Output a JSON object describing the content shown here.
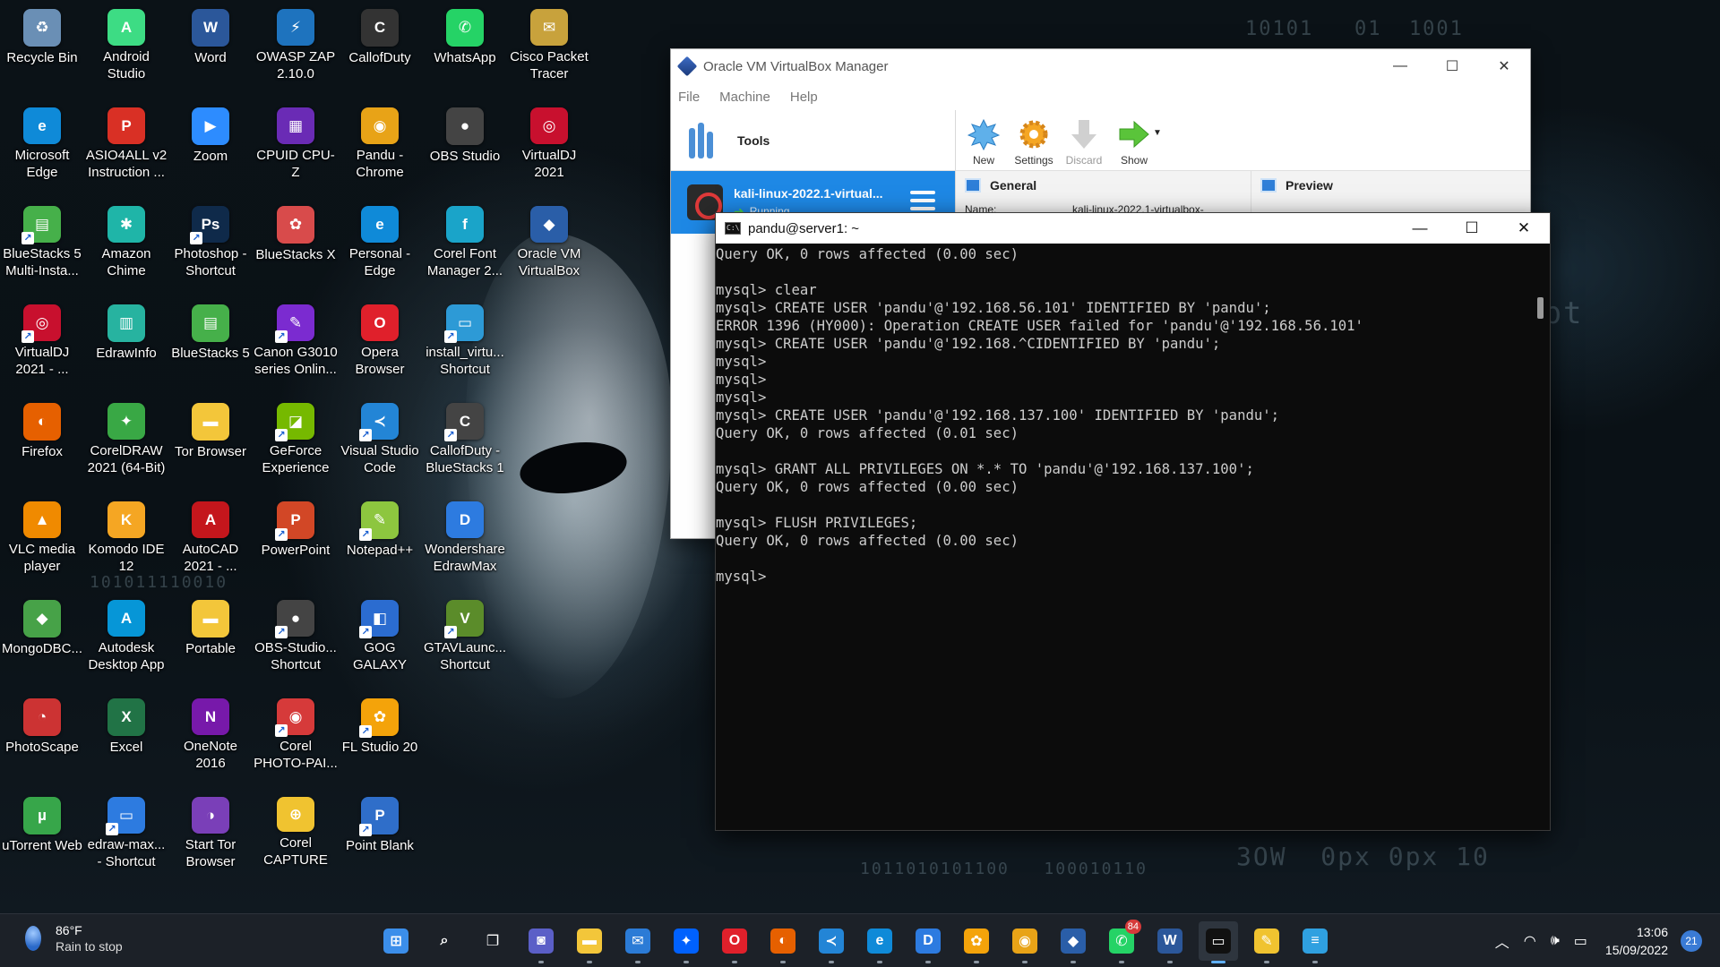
{
  "desktop": {
    "icons": [
      {
        "label": "Recycle Bin",
        "glyph": "♻",
        "color": "#6a8fb5",
        "shortcut": false
      },
      {
        "label": "Android\nStudio",
        "glyph": "A",
        "color": "#3ddc84",
        "shortcut": false
      },
      {
        "label": "Word",
        "glyph": "W",
        "color": "#2b579a",
        "shortcut": false
      },
      {
        "label": "OWASP ZAP\n2.10.0",
        "glyph": "⚡",
        "color": "#1e73be",
        "shortcut": false
      },
      {
        "label": "CallofDuty",
        "glyph": "C",
        "color": "#333333",
        "shortcut": false
      },
      {
        "label": "WhatsApp",
        "glyph": "✆",
        "color": "#25d366",
        "shortcut": false
      },
      {
        "label": "Cisco Packet\nTracer",
        "glyph": "✉",
        "color": "#c8a23c",
        "shortcut": false
      },
      {
        "label": "Microsoft\nEdge",
        "glyph": "e",
        "color": "#0f8ad8",
        "shortcut": false
      },
      {
        "label": "ASIO4ALL v2\nInstruction ...",
        "glyph": "P",
        "color": "#d93025",
        "shortcut": false
      },
      {
        "label": "Zoom",
        "glyph": "▶",
        "color": "#2d8cff",
        "shortcut": false
      },
      {
        "label": "CPUID CPU-Z",
        "glyph": "▦",
        "color": "#6a2bb5",
        "shortcut": false
      },
      {
        "label": "Pandu -\nChrome",
        "glyph": "◉",
        "color": "#e8a317",
        "shortcut": false
      },
      {
        "label": "OBS Studio",
        "glyph": "●",
        "color": "#444444",
        "shortcut": false
      },
      {
        "label": "VirtualDJ\n2021",
        "glyph": "◎",
        "color": "#c8102e",
        "shortcut": false
      },
      {
        "label": "BlueStacks 5\nMulti-Insta...",
        "glyph": "▤",
        "color": "#46b04a",
        "shortcut": true
      },
      {
        "label": "Amazon\nChime",
        "glyph": "✱",
        "color": "#1fb5a8",
        "shortcut": false
      },
      {
        "label": "Photoshop -\nShortcut",
        "glyph": "Ps",
        "color": "#0f2a4a",
        "shortcut": true
      },
      {
        "label": "BlueStacks X",
        "glyph": "✿",
        "color": "#d84b4b",
        "shortcut": false
      },
      {
        "label": "Personal -\nEdge",
        "glyph": "e",
        "color": "#0f8ad8",
        "shortcut": false
      },
      {
        "label": "Corel Font\nManager 2...",
        "glyph": "f",
        "color": "#1aa4c9",
        "shortcut": false
      },
      {
        "label": "Oracle VM\nVirtualBox",
        "glyph": "◆",
        "color": "#2a5ea8",
        "shortcut": false
      },
      {
        "label": "VirtualDJ\n2021 - ...",
        "glyph": "◎",
        "color": "#c8102e",
        "shortcut": true
      },
      {
        "label": "EdrawInfo",
        "glyph": "▥",
        "color": "#27b3a0",
        "shortcut": false
      },
      {
        "label": "BlueStacks 5",
        "glyph": "▤",
        "color": "#46b04a",
        "shortcut": false
      },
      {
        "label": "Canon G3010\nseries Onlin...",
        "glyph": "✎",
        "color": "#7b2bd0",
        "shortcut": true
      },
      {
        "label": "Opera\nBrowser",
        "glyph": "O",
        "color": "#e0202b",
        "shortcut": false
      },
      {
        "label": "install_virtu...\nShortcut",
        "glyph": "▭",
        "color": "#2d9ad6",
        "shortcut": true
      },
      {
        "label": "Firefox",
        "glyph": "◐",
        "color": "#e66000",
        "shortcut": false
      },
      {
        "label": "CorelDRAW\n2021 (64-Bit)",
        "glyph": "✦",
        "color": "#39a845",
        "shortcut": false
      },
      {
        "label": "Tor Browser",
        "glyph": "▬",
        "color": "#f3c63a",
        "shortcut": false
      },
      {
        "label": "GeForce\nExperience",
        "glyph": "◪",
        "color": "#76b900",
        "shortcut": true
      },
      {
        "label": "Visual Studio\nCode",
        "glyph": "≺",
        "color": "#2385d6",
        "shortcut": true
      },
      {
        "label": "CallofDuty -\nBlueStacks 1",
        "glyph": "C",
        "color": "#444444",
        "shortcut": true
      },
      {
        "label": "VLC media\nplayer",
        "glyph": "▲",
        "color": "#f08a00",
        "shortcut": false
      },
      {
        "label": "Komodo IDE\n12",
        "glyph": "K",
        "color": "#f5a623",
        "shortcut": false
      },
      {
        "label": "AutoCAD\n2021 - ...",
        "glyph": "A",
        "color": "#c4161c",
        "shortcut": false
      },
      {
        "label": "PowerPoint",
        "glyph": "P",
        "color": "#d24726",
        "shortcut": true
      },
      {
        "label": "Notepad++",
        "glyph": "✎",
        "color": "#8dc63f",
        "shortcut": true
      },
      {
        "label": "Wondershare\nEdrawMax",
        "glyph": "D",
        "color": "#2d7be0",
        "shortcut": false
      },
      {
        "label": "MongoDBC...",
        "glyph": "◆",
        "color": "#47a248",
        "shortcut": false
      },
      {
        "label": "Autodesk\nDesktop App",
        "glyph": "A",
        "color": "#0696d7",
        "shortcut": false
      },
      {
        "label": "Portable",
        "glyph": "▬",
        "color": "#f3c63a",
        "shortcut": false
      },
      {
        "label": "OBS-Studio...\nShortcut",
        "glyph": "●",
        "color": "#444444",
        "shortcut": true
      },
      {
        "label": "GOG GALAXY",
        "glyph": "◧",
        "color": "#2b6cd0",
        "shortcut": true
      },
      {
        "label": "GTAVLaunc...\nShortcut",
        "glyph": "V",
        "color": "#5b8c2a",
        "shortcut": true
      },
      {
        "label": "PhotoScape",
        "glyph": "◔",
        "color": "#cc3333",
        "shortcut": false
      },
      {
        "label": "Excel",
        "glyph": "X",
        "color": "#217346",
        "shortcut": false
      },
      {
        "label": "OneNote\n2016",
        "glyph": "N",
        "color": "#7719aa",
        "shortcut": false
      },
      {
        "label": "Corel\nPHOTO-PAI...",
        "glyph": "◉",
        "color": "#d63a3a",
        "shortcut": true
      },
      {
        "label": "FL Studio 20",
        "glyph": "✿",
        "color": "#f4a30a",
        "shortcut": true
      },
      {
        "label": "uTorrent Web",
        "glyph": "µ",
        "color": "#37a64a",
        "shortcut": false
      },
      {
        "label": "edraw-max...\n- Shortcut",
        "glyph": "▭",
        "color": "#2d7be0",
        "shortcut": true
      },
      {
        "label": "Start Tor\nBrowser",
        "glyph": "◑",
        "color": "#7a3fb8",
        "shortcut": false
      },
      {
        "label": "Corel\nCAPTURE 2...",
        "glyph": "⊕",
        "color": "#f0c330",
        "shortcut": false
      },
      {
        "label": "Point Blank",
        "glyph": "P",
        "color": "#2f6ec9",
        "shortcut": true
      }
    ]
  },
  "vbox": {
    "title": "Oracle VM VirtualBox Manager",
    "menu": [
      "File",
      "Machine",
      "Help"
    ],
    "tools_label": "Tools",
    "vm": {
      "name": "kali-linux-2022.1-virtual...",
      "state": "Running"
    },
    "toolbar": [
      {
        "label": "New",
        "icon": "new-icon",
        "disabled": false
      },
      {
        "label": "Settings",
        "icon": "settings-icon",
        "disabled": false
      },
      {
        "label": "Discard",
        "icon": "discard-icon",
        "disabled": true
      },
      {
        "label": "Show",
        "icon": "show-icon",
        "disabled": false
      }
    ],
    "general_title": "General",
    "general_name_key": "Name:",
    "general_name_value": "kali-linux-2022.1-virtualbox-",
    "preview_title": "Preview"
  },
  "terminal": {
    "title": "pandu@server1: ~",
    "lines": [
      "Query OK, 0 rows affected (0.00 sec)",
      "",
      "mysql> clear",
      "mysql> CREATE USER 'pandu'@'192.168.56.101' IDENTIFIED BY 'pandu';",
      "ERROR 1396 (HY000): Operation CREATE USER failed for 'pandu'@'192.168.56.101'",
      "mysql> CREATE USER 'pandu'@'192.168.^CIDENTIFIED BY 'pandu';",
      "mysql>",
      "mysql>",
      "mysql>",
      "mysql> CREATE USER 'pandu'@'192.168.137.100' IDENTIFIED BY 'pandu';",
      "Query OK, 0 rows affected (0.01 sec)",
      "",
      "mysql> GRANT ALL PRIVILEGES ON *.* TO 'pandu'@'192.168.137.100';",
      "Query OK, 0 rows affected (0.00 sec)",
      "",
      "mysql> FLUSH PRIVILEGES;",
      "Query OK, 0 rows affected (0.00 sec)",
      "",
      "mysql> "
    ]
  },
  "taskbar": {
    "weather": {
      "temp": "86°F",
      "condition": "Rain to stop"
    },
    "apps": [
      {
        "name": "start-icon",
        "glyph": "⊞",
        "color": "#3b8eea"
      },
      {
        "name": "search-icon",
        "glyph": "⌕",
        "color": "transparent"
      },
      {
        "name": "task-view-icon",
        "glyph": "❐",
        "color": "transparent"
      },
      {
        "name": "chat-icon",
        "glyph": "◙",
        "color": "#5b5fc7"
      },
      {
        "name": "file-explorer-icon",
        "glyph": "▬",
        "color": "#f3c63a"
      },
      {
        "name": "mail-icon",
        "glyph": "✉",
        "color": "#2b7bd6"
      },
      {
        "name": "dropbox-icon",
        "glyph": "✦",
        "color": "#0061fe"
      },
      {
        "name": "opera-icon",
        "glyph": "O",
        "color": "#e0202b"
      },
      {
        "name": "firefox-icon",
        "glyph": "◐",
        "color": "#e66000"
      },
      {
        "name": "vscode-icon",
        "glyph": "≺",
        "color": "#2385d6"
      },
      {
        "name": "edge-icon",
        "glyph": "e",
        "color": "#0f8ad8"
      },
      {
        "name": "edrawmax-icon",
        "glyph": "D",
        "color": "#2d7be0"
      },
      {
        "name": "fl-studio-icon",
        "glyph": "✿",
        "color": "#f4a30a"
      },
      {
        "name": "chrome-icon",
        "glyph": "◉",
        "color": "#e8a317"
      },
      {
        "name": "virtualbox-icon",
        "glyph": "◆",
        "color": "#2a5ea8"
      },
      {
        "name": "whatsapp-icon",
        "glyph": "✆",
        "color": "#25d366",
        "badge": "84"
      },
      {
        "name": "word-icon",
        "glyph": "W",
        "color": "#2b579a"
      },
      {
        "name": "terminal-icon",
        "glyph": "▭",
        "color": "#111111",
        "active": true
      },
      {
        "name": "corel-icon",
        "glyph": "✎",
        "color": "#f0c330"
      },
      {
        "name": "notepad-icon",
        "glyph": "≡",
        "color": "#2fa0e0"
      }
    ],
    "tray": {
      "time": "13:06",
      "date": "15/09/2022",
      "notifications": "21"
    }
  }
}
